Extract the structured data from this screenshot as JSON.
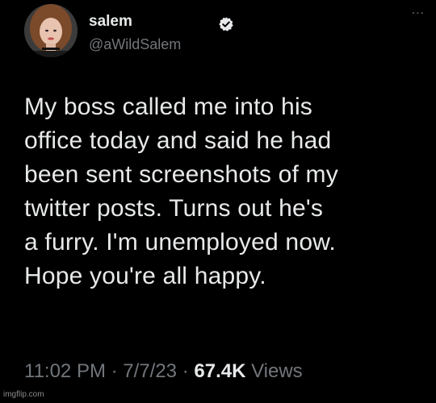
{
  "author": {
    "display_name": "salem",
    "handle": "@aWildSalem",
    "verified": true
  },
  "tweet": {
    "lines": [
      "My boss called me into his",
      "office today and said he had",
      "been sent screenshots of my",
      "twitter posts. Turns out he's",
      "a furry. I'm unemployed now.",
      "Hope you're all happy."
    ]
  },
  "meta": {
    "time": "11:02 PM",
    "separator": "·",
    "date": "7/7/23",
    "views_count": "67.4K",
    "views_label": "Views"
  },
  "more_label": "...",
  "watermark": "imgflip.com",
  "colors": {
    "background": "#000000",
    "primary_text": "#e7e9ea",
    "secondary_text": "#71767b"
  }
}
